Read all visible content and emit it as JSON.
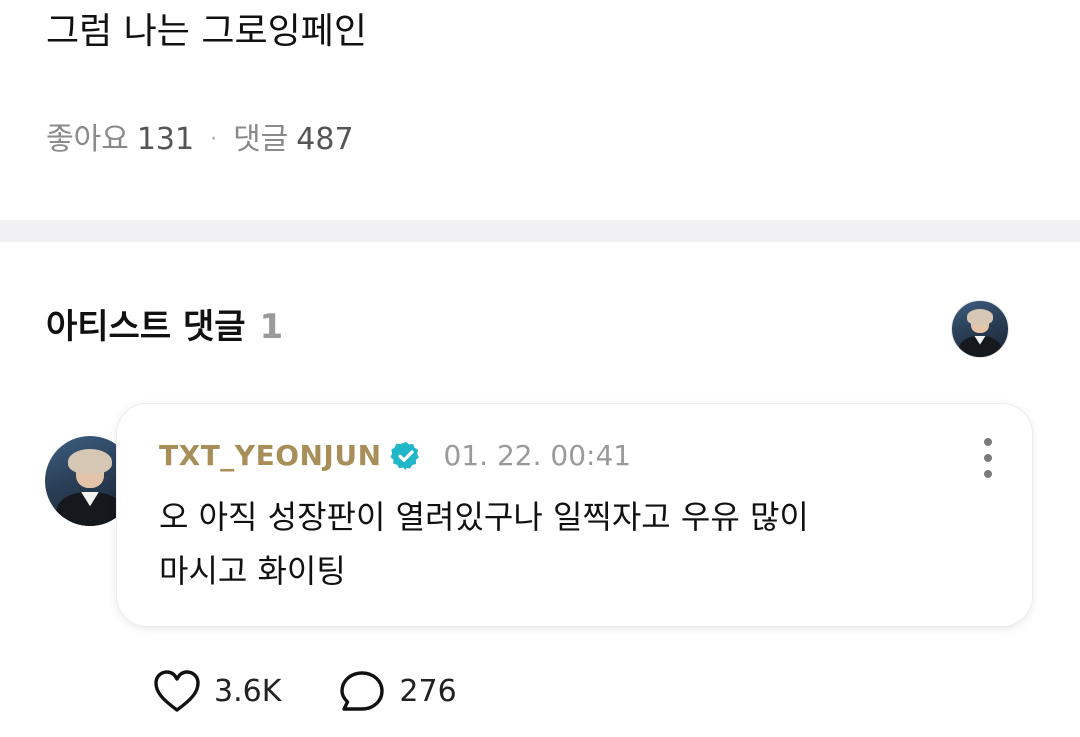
{
  "post": {
    "text": "그럼 나는 그로잉페인",
    "likes_label": "좋아요",
    "likes_count": "131",
    "separator": "·",
    "comments_label": "댓글",
    "comments_count": "487"
  },
  "artist_section": {
    "title": "아티스트 댓글",
    "count": "1"
  },
  "comment": {
    "author": "TXT_YEONJUN",
    "verified_icon": "verified-badge-icon",
    "timestamp": "01. 22. 00:41",
    "line1": "오 아직 성장판이 열려있구나 일찍자고 우유 많이",
    "line2": "마시고 화이팅",
    "like_count": "3.6K",
    "reply_count": "276"
  },
  "colors": {
    "author": "#a88f5a",
    "verified": "#20b7c9",
    "divider": "#f1f1f3"
  }
}
